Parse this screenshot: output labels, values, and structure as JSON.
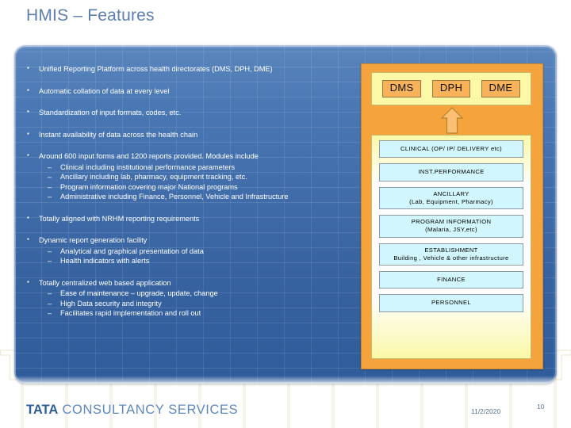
{
  "slide": {
    "title": "HMIS – Features"
  },
  "bullets": [
    {
      "text": "Unified Reporting Platform across health directorates (DMS, DPH, DME)",
      "sub": []
    },
    {
      "text": "Automatic collation of data at every level",
      "sub": []
    },
    {
      "text": "Standardization of input formats, codes, etc.",
      "sub": []
    },
    {
      "text": "Instant availability of data across the health chain",
      "sub": []
    },
    {
      "text": "Around 600 input forms and 1200 reports provided. Modules include",
      "sub": [
        "Clinical including institutional performance parameters",
        "Ancillary including lab, pharmacy, equipment tracking, etc.",
        "Program information covering major National programs",
        "Administrative including Finance, Personnel, Vehicle and Infrastructure"
      ]
    },
    {
      "text": "Totally aligned with NRHM reporting requirements",
      "sub": []
    },
    {
      "text": "Dynamic report generation facility",
      "sub": [
        "Analytical and graphical presentation of data",
        "Health indicators with alerts"
      ]
    },
    {
      "text": "Totally centralized web based application",
      "sub": [
        "Ease of maintenance – upgrade, update, change",
        "High Data security and integrity",
        "Facilitates rapid implementation and roll out"
      ]
    }
  ],
  "diagram": {
    "directorates": [
      "DMS",
      "DPH",
      "DME"
    ],
    "arrow": "up-arrow-icon",
    "modules": [
      {
        "line1": "CLINICAL (OP/ IP/ DELIVERY etc)",
        "line2": ""
      },
      {
        "line1": "INST.PERFORMANCE",
        "line2": ""
      },
      {
        "line1": "ANCILLARY",
        "line2": "(Lab, Equipment, Pharmacy)"
      },
      {
        "line1": "PROGRAM  INFORMATION",
        "line2": "(Malaria, JSY,etc)"
      },
      {
        "line1": "ESTABLISHMENT",
        "line2": "Building , Vehicle & other infrastructure"
      },
      {
        "line1": "FINANCE",
        "line2": ""
      },
      {
        "line1": "PERSONNEL",
        "line2": ""
      }
    ]
  },
  "footer": {
    "logo_brand": "TATA",
    "logo_rest": " CONSULTANCY SERVICES",
    "date": "11/2/2020",
    "page_number": "10"
  },
  "colors": {
    "title": "#5b7fae",
    "panel_blue": "#4a78b4",
    "diagram_orange": "#f5a33c",
    "directorate_yellow": "#fbf8a8",
    "module_cyan": "#d2f6fd",
    "logo_blue": "#2c5f9e"
  }
}
